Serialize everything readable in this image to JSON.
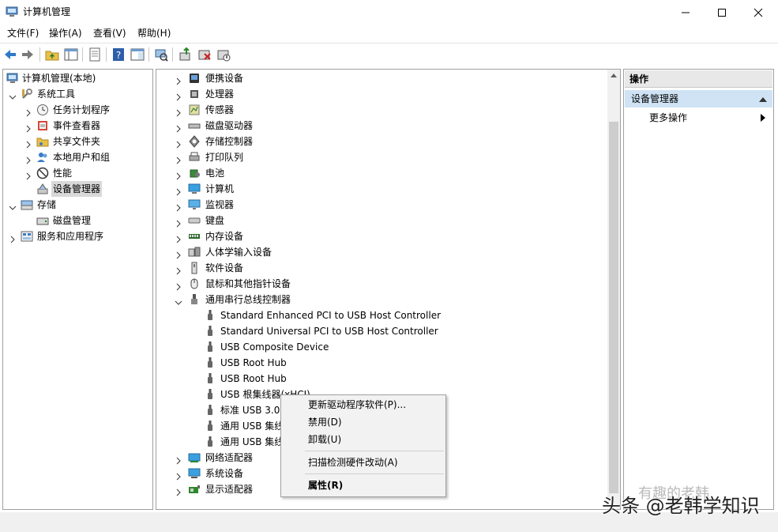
{
  "window": {
    "title": "计算机管理",
    "buttons": [
      "minimize",
      "maximize",
      "close"
    ]
  },
  "menu": [
    "文件(F)",
    "操作(A)",
    "查看(V)",
    "帮助(H)"
  ],
  "toolbar_icons": [
    "back-arrow-icon",
    "forward-arrow-icon",
    "up-folder-icon",
    "show-hide-tree-icon",
    "properties-icon",
    "help-icon",
    "view-icon",
    "scan-icon",
    "update-driver-icon",
    "uninstall-icon",
    "disable-icon"
  ],
  "tree": {
    "root": "计算机管理(本地)",
    "system_tools": "系统工具",
    "system_children": [
      "任务计划程序",
      "事件查看器",
      "共享文件夹",
      "本地用户和组",
      "性能",
      "设备管理器"
    ],
    "storage": "存储",
    "storage_children": [
      "磁盘管理"
    ],
    "services": "服务和应用程序"
  },
  "devices": {
    "categories_top": [
      "便携设备",
      "处理器",
      "传感器",
      "磁盘驱动器",
      "存储控制器",
      "打印队列",
      "电池",
      "计算机",
      "监视器",
      "键盘",
      "内存设备",
      "人体学输入设备",
      "软件设备",
      "鼠标和其他指针设备"
    ],
    "usb_category": "通用串行总线控制器",
    "usb_children": [
      "Standard Enhanced PCI to USB Host Controller",
      "Standard Universal PCI to USB Host Controller",
      "USB Composite Device",
      "USB Root Hub",
      "USB Root Hub",
      "USB 根集线器(xHCI)",
      "标准 USB 3.0",
      "通用 USB 集线器",
      "通用 USB 集线器"
    ],
    "categories_bottom": [
      "网络适配器",
      "系统设备",
      "显示适配器"
    ]
  },
  "actions": {
    "header": "操作",
    "section": "设备管理器",
    "more": "更多操作"
  },
  "context_menu": {
    "items": [
      "更新驱动程序软件(P)...",
      "禁用(D)",
      "卸载(U)",
      "扫描检测硬件改动(A)",
      "属性(R)"
    ]
  },
  "watermark": {
    "main": "头条 @老韩学知识",
    "faint": "有趣的老韩"
  }
}
